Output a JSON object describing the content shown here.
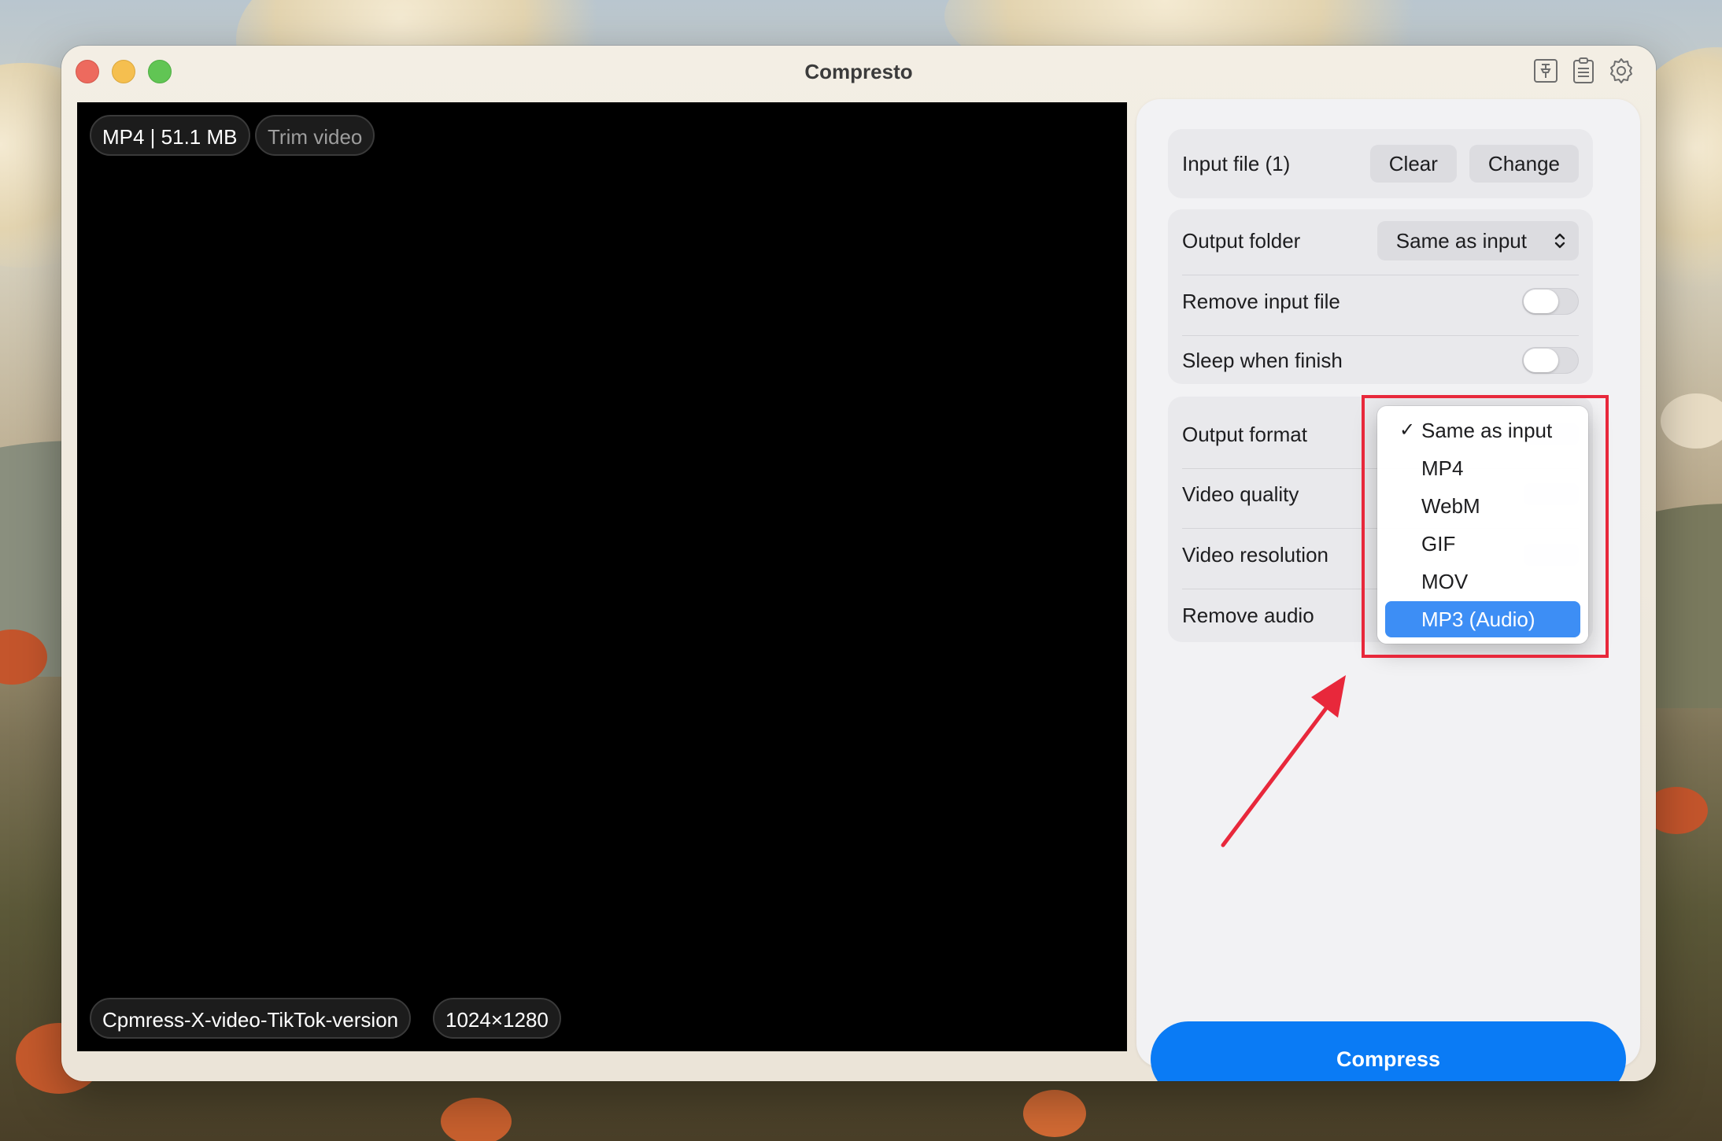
{
  "window": {
    "title": "Compresto"
  },
  "toolbar": {
    "icons": [
      "pin-icon",
      "clipboard-icon",
      "gear-icon"
    ]
  },
  "video": {
    "format_size": "MP4 | 51.1 MB",
    "trim_label": "Trim video",
    "filename": "Cpmress-X-video-TikTok-version",
    "dimensions": "1024×1280"
  },
  "panel": {
    "input": {
      "label": "Input file (1)",
      "clear": "Clear",
      "change": "Change"
    },
    "output_folder": {
      "label": "Output folder",
      "value": "Same as input"
    },
    "remove_input": {
      "label": "Remove input file",
      "on": false
    },
    "sleep_finish": {
      "label": "Sleep when finish",
      "on": false
    },
    "output_format": {
      "label": "Output format"
    },
    "video_quality": {
      "label": "Video quality"
    },
    "video_resolution": {
      "label": "Video resolution"
    },
    "remove_audio": {
      "label": "Remove audio"
    },
    "compress_button": "Compress"
  },
  "format_menu": {
    "items": [
      "Same as input",
      "MP4",
      "WebM",
      "GIF",
      "MOV",
      "MP3 (Audio)"
    ],
    "checked": "Same as input",
    "highlighted": "MP3 (Audio)"
  },
  "colors": {
    "accent": "#0a7bf5",
    "menu_highlight": "#3d8ef5",
    "annotation": "#e8283b"
  }
}
